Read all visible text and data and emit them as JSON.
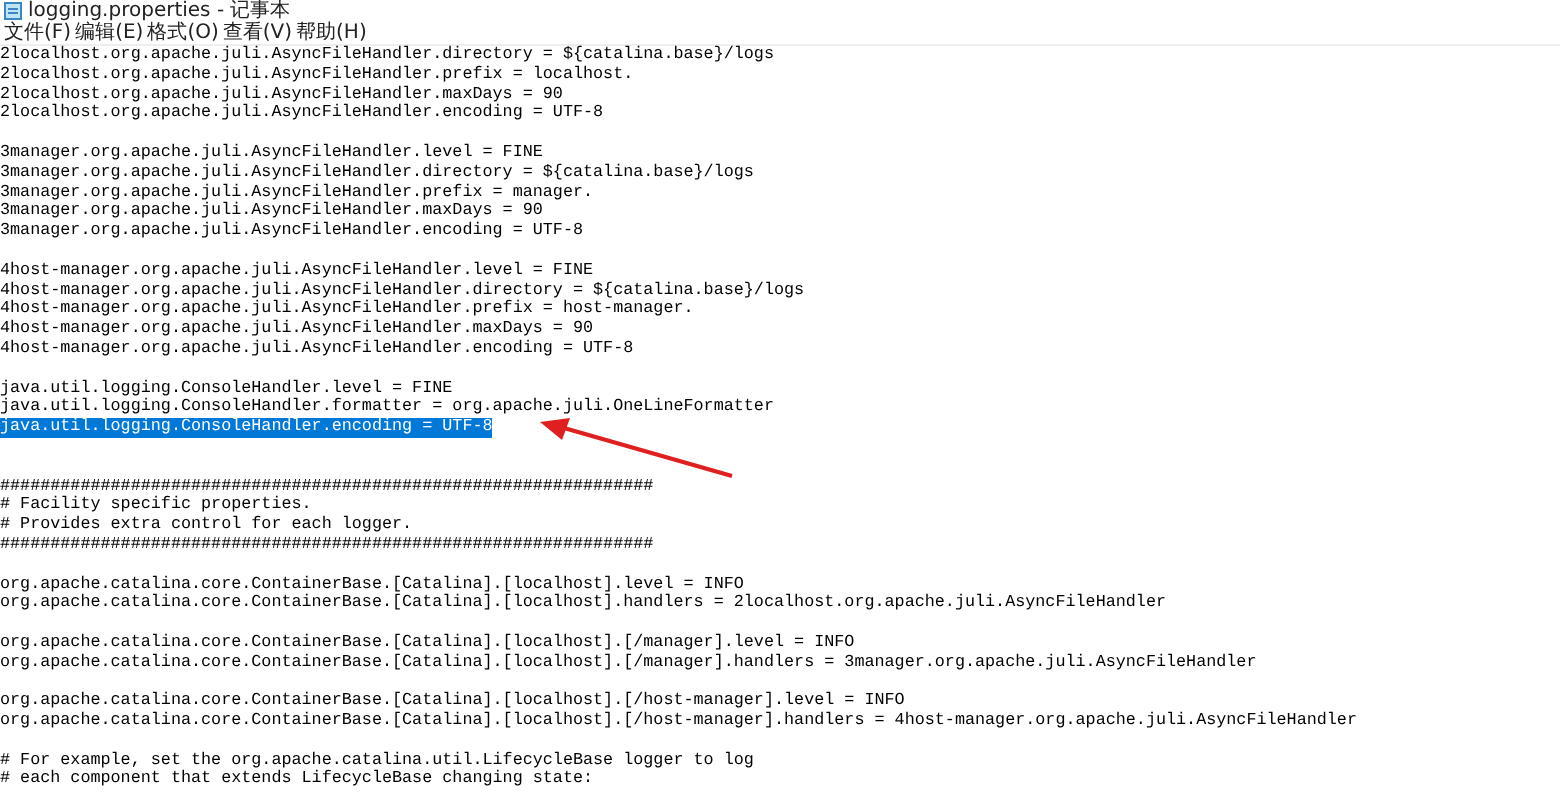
{
  "window": {
    "title": "logging.properties - 记事本"
  },
  "menu": [
    "文件(F)",
    "编辑(E)",
    "格式(O)",
    "查看(V)",
    "帮助(H)"
  ],
  "editor": {
    "blocks": [
      {
        "kind": "plain",
        "lines": [
          {
            "text": "2localhost.org.apache.juli.AsyncFileHandler.directory = ${catalina.base}/logs",
            "selected": false
          },
          {
            "text": "2localhost.org.apache.juli.AsyncFileHandler.prefix = localhost.",
            "selected": false
          },
          {
            "text": "2localhost.org.apache.juli.AsyncFileHandler.maxDays = 90",
            "selected": false
          },
          {
            "text": "2localhost.org.apache.juli.AsyncFileHandler.encoding = UTF-8",
            "selected": false
          }
        ]
      },
      {
        "kind": "plain",
        "lines": [
          {
            "text": "3manager.org.apache.juli.AsyncFileHandler.level = FINE",
            "selected": false
          },
          {
            "text": "3manager.org.apache.juli.AsyncFileHandler.directory = ${catalina.base}/logs",
            "selected": false
          },
          {
            "text": "3manager.org.apache.juli.AsyncFileHandler.prefix = manager.",
            "selected": false
          },
          {
            "text": "3manager.org.apache.juli.AsyncFileHandler.maxDays = 90",
            "selected": false
          },
          {
            "text": "3manager.org.apache.juli.AsyncFileHandler.encoding = UTF-8",
            "selected": false
          }
        ]
      },
      {
        "kind": "plain",
        "lines": [
          {
            "text": "4host-manager.org.apache.juli.AsyncFileHandler.level = FINE",
            "selected": false
          },
          {
            "text": "4host-manager.org.apache.juli.AsyncFileHandler.directory = ${catalina.base}/logs",
            "selected": false
          },
          {
            "text": "4host-manager.org.apache.juli.AsyncFileHandler.prefix = host-manager.",
            "selected": false
          },
          {
            "text": "4host-manager.org.apache.juli.AsyncFileHandler.maxDays = 90",
            "selected": false
          },
          {
            "text": "4host-manager.org.apache.juli.AsyncFileHandler.encoding = UTF-8",
            "selected": false
          }
        ]
      },
      {
        "kind": "plain",
        "lines": [
          {
            "text": "java.util.logging.ConsoleHandler.level = FINE",
            "selected": false
          },
          {
            "text": "java.util.logging.ConsoleHandler.formatter = org.apache.juli.OneLineFormatter",
            "selected": false
          },
          {
            "text": "java.util.logging.ConsoleHandler.encoding = UTF-8",
            "selected": true
          }
        ]
      },
      {
        "kind": "spaced",
        "lines": [
          {
            "text": "#################################################################",
            "selected": false
          },
          {
            "text": "# Facility specific properties.",
            "selected": false
          },
          {
            "text": "# Provides extra control for each logger.",
            "selected": false
          },
          {
            "text": "#################################################################",
            "selected": false
          }
        ]
      },
      {
        "kind": "plain",
        "lines": [
          {
            "text": "org.apache.catalina.core.ContainerBase.[Catalina].[localhost].level = INFO",
            "selected": false
          },
          {
            "text": "org.apache.catalina.core.ContainerBase.[Catalina].[localhost].handlers = 2localhost.org.apache.juli.AsyncFileHandler",
            "selected": false
          }
        ]
      },
      {
        "kind": "plain",
        "lines": [
          {
            "text": "org.apache.catalina.core.ContainerBase.[Catalina].[localhost].[/manager].level = INFO",
            "selected": false
          },
          {
            "text": "org.apache.catalina.core.ContainerBase.[Catalina].[localhost].[/manager].handlers = 3manager.org.apache.juli.AsyncFileHandler",
            "selected": false
          }
        ]
      },
      {
        "kind": "plain",
        "lines": [
          {
            "text": "org.apache.catalina.core.ContainerBase.[Catalina].[localhost].[/host-manager].level = INFO",
            "selected": false
          },
          {
            "text": "org.apache.catalina.core.ContainerBase.[Catalina].[localhost].[/host-manager].handlers = 4host-manager.org.apache.juli.AsyncFileHandler",
            "selected": false
          }
        ]
      },
      {
        "kind": "plain",
        "lines": [
          {
            "text": "# For example, set the org.apache.catalina.util.LifecycleBase logger to log",
            "selected": false
          },
          {
            "text": "# each component that extends LifecycleBase changing state:",
            "selected": false
          }
        ]
      }
    ]
  }
}
